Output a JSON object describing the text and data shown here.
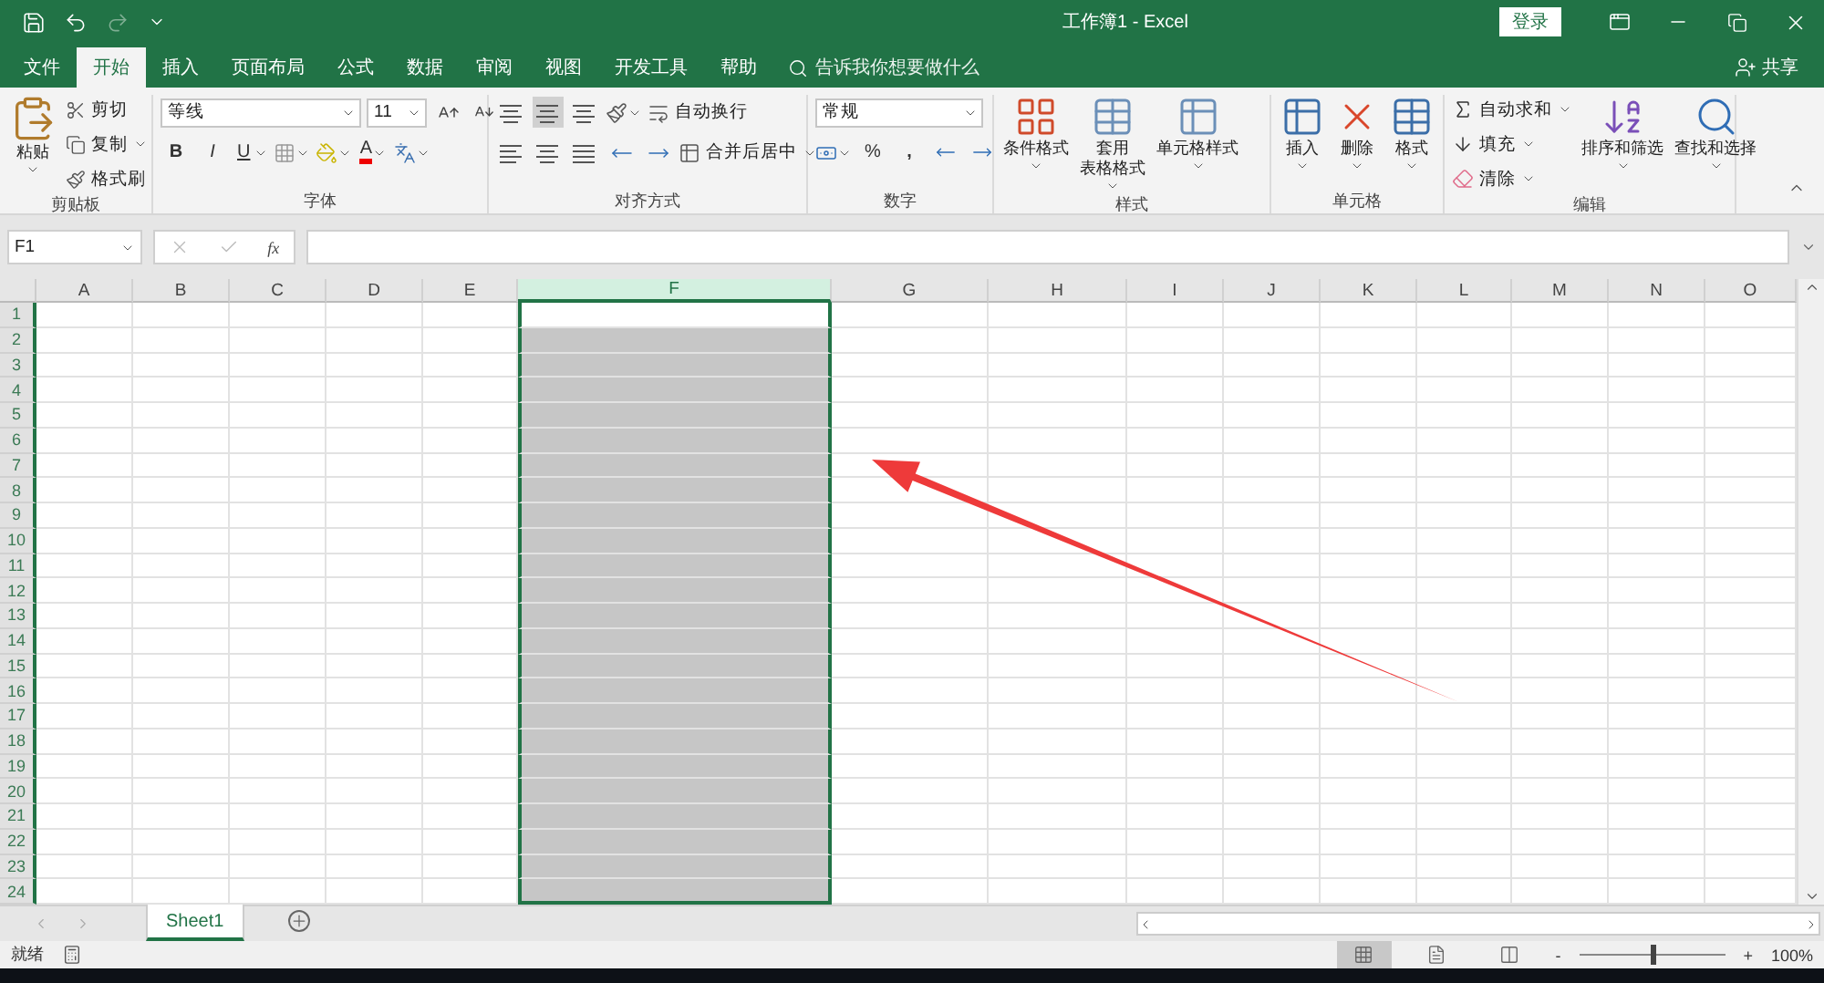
{
  "title_bar": {
    "title": "工作簿1 - Excel",
    "sign_in": "登录"
  },
  "tabs": [
    {
      "label": "文件",
      "selected": false
    },
    {
      "label": "开始",
      "selected": true
    },
    {
      "label": "插入",
      "selected": false
    },
    {
      "label": "页面布局",
      "selected": false
    },
    {
      "label": "公式",
      "selected": false
    },
    {
      "label": "数据",
      "selected": false
    },
    {
      "label": "审阅",
      "selected": false
    },
    {
      "label": "视图",
      "selected": false
    },
    {
      "label": "开发工具",
      "selected": false
    },
    {
      "label": "帮助",
      "selected": false
    }
  ],
  "tell_me": {
    "placeholder": "告诉我你想要做什么"
  },
  "share": "共享",
  "ribbon": [
    {
      "kind": "clipboard",
      "label": "剪贴板",
      "paste": "粘贴",
      "items": [
        "剪切",
        "复制",
        "格式刷"
      ]
    },
    {
      "kind": "font",
      "label": "字体",
      "font": "等线",
      "size": "11",
      "bold": "B",
      "italic": "I",
      "underline": "U",
      "font_color": "A"
    },
    {
      "kind": "alignment",
      "label": "对齐方式",
      "vertical": [
        {
          "selected": false
        },
        {
          "selected": true
        },
        {
          "selected": false
        }
      ],
      "wrap": "自动换行",
      "merge": "合并后居中"
    },
    {
      "kind": "number",
      "label": "数字",
      "format": "常规",
      "percent": "%",
      "comma": ","
    },
    {
      "kind": "styles",
      "label": "样式",
      "buttons": [
        {
          "lines": [
            "条件格式"
          ]
        },
        {
          "lines": [
            "套用",
            "表格格式"
          ]
        },
        {
          "lines": [
            "单元格样式"
          ]
        }
      ]
    },
    {
      "kind": "cells",
      "label": "单元格",
      "buttons": [
        "插入",
        "删除",
        "格式"
      ]
    },
    {
      "kind": "editing",
      "label": "编辑",
      "small": [
        "自动求和",
        "填充",
        "清除"
      ],
      "big": [
        "排序和筛选",
        "查找和选择"
      ]
    }
  ],
  "formula_bar": {
    "name_box": "F1",
    "fx": "fx"
  },
  "columns": [
    {
      "label": "A",
      "selected": false
    },
    {
      "label": "B",
      "selected": false
    },
    {
      "label": "C",
      "selected": false
    },
    {
      "label": "D",
      "selected": false
    },
    {
      "label": "E",
      "selected": false
    },
    {
      "label": "F",
      "selected": true
    },
    {
      "label": "G",
      "selected": false
    },
    {
      "label": "H",
      "selected": false
    },
    {
      "label": "I",
      "selected": false
    },
    {
      "label": "J",
      "selected": false
    },
    {
      "label": "K",
      "selected": false
    },
    {
      "label": "L",
      "selected": false
    },
    {
      "label": "M",
      "selected": false
    },
    {
      "label": "N",
      "selected": false
    },
    {
      "label": "O",
      "selected": false
    }
  ],
  "rows": [
    {
      "label": "1",
      "shaded": false
    },
    {
      "label": "2",
      "shaded": true
    },
    {
      "label": "3",
      "shaded": true
    },
    {
      "label": "4",
      "shaded": true
    },
    {
      "label": "5",
      "shaded": true
    },
    {
      "label": "6",
      "shaded": true
    },
    {
      "label": "7",
      "shaded": true
    },
    {
      "label": "8",
      "shaded": true
    },
    {
      "label": "9",
      "shaded": true
    },
    {
      "label": "10",
      "shaded": true
    },
    {
      "label": "11",
      "shaded": true
    },
    {
      "label": "12",
      "shaded": true
    },
    {
      "label": "13",
      "shaded": true
    },
    {
      "label": "14",
      "shaded": true
    },
    {
      "label": "15",
      "shaded": true
    },
    {
      "label": "16",
      "shaded": true
    },
    {
      "label": "17",
      "shaded": true
    },
    {
      "label": "18",
      "shaded": true
    },
    {
      "label": "19",
      "shaded": true
    },
    {
      "label": "20",
      "shaded": true
    },
    {
      "label": "21",
      "shaded": true
    },
    {
      "label": "22",
      "shaded": true
    },
    {
      "label": "23",
      "shaded": true
    },
    {
      "label": "24",
      "shaded": true
    }
  ],
  "sheets": [
    {
      "label": "Sheet1",
      "selected": true
    }
  ],
  "status_bar": {
    "text": "就绪",
    "views": [
      {
        "selected": true
      },
      {
        "selected": false
      },
      {
        "selected": false
      }
    ],
    "zoom_out": "-",
    "zoom_in": "+",
    "zoom": {
      "level": 0.5
    },
    "zoom_text": "100%"
  }
}
